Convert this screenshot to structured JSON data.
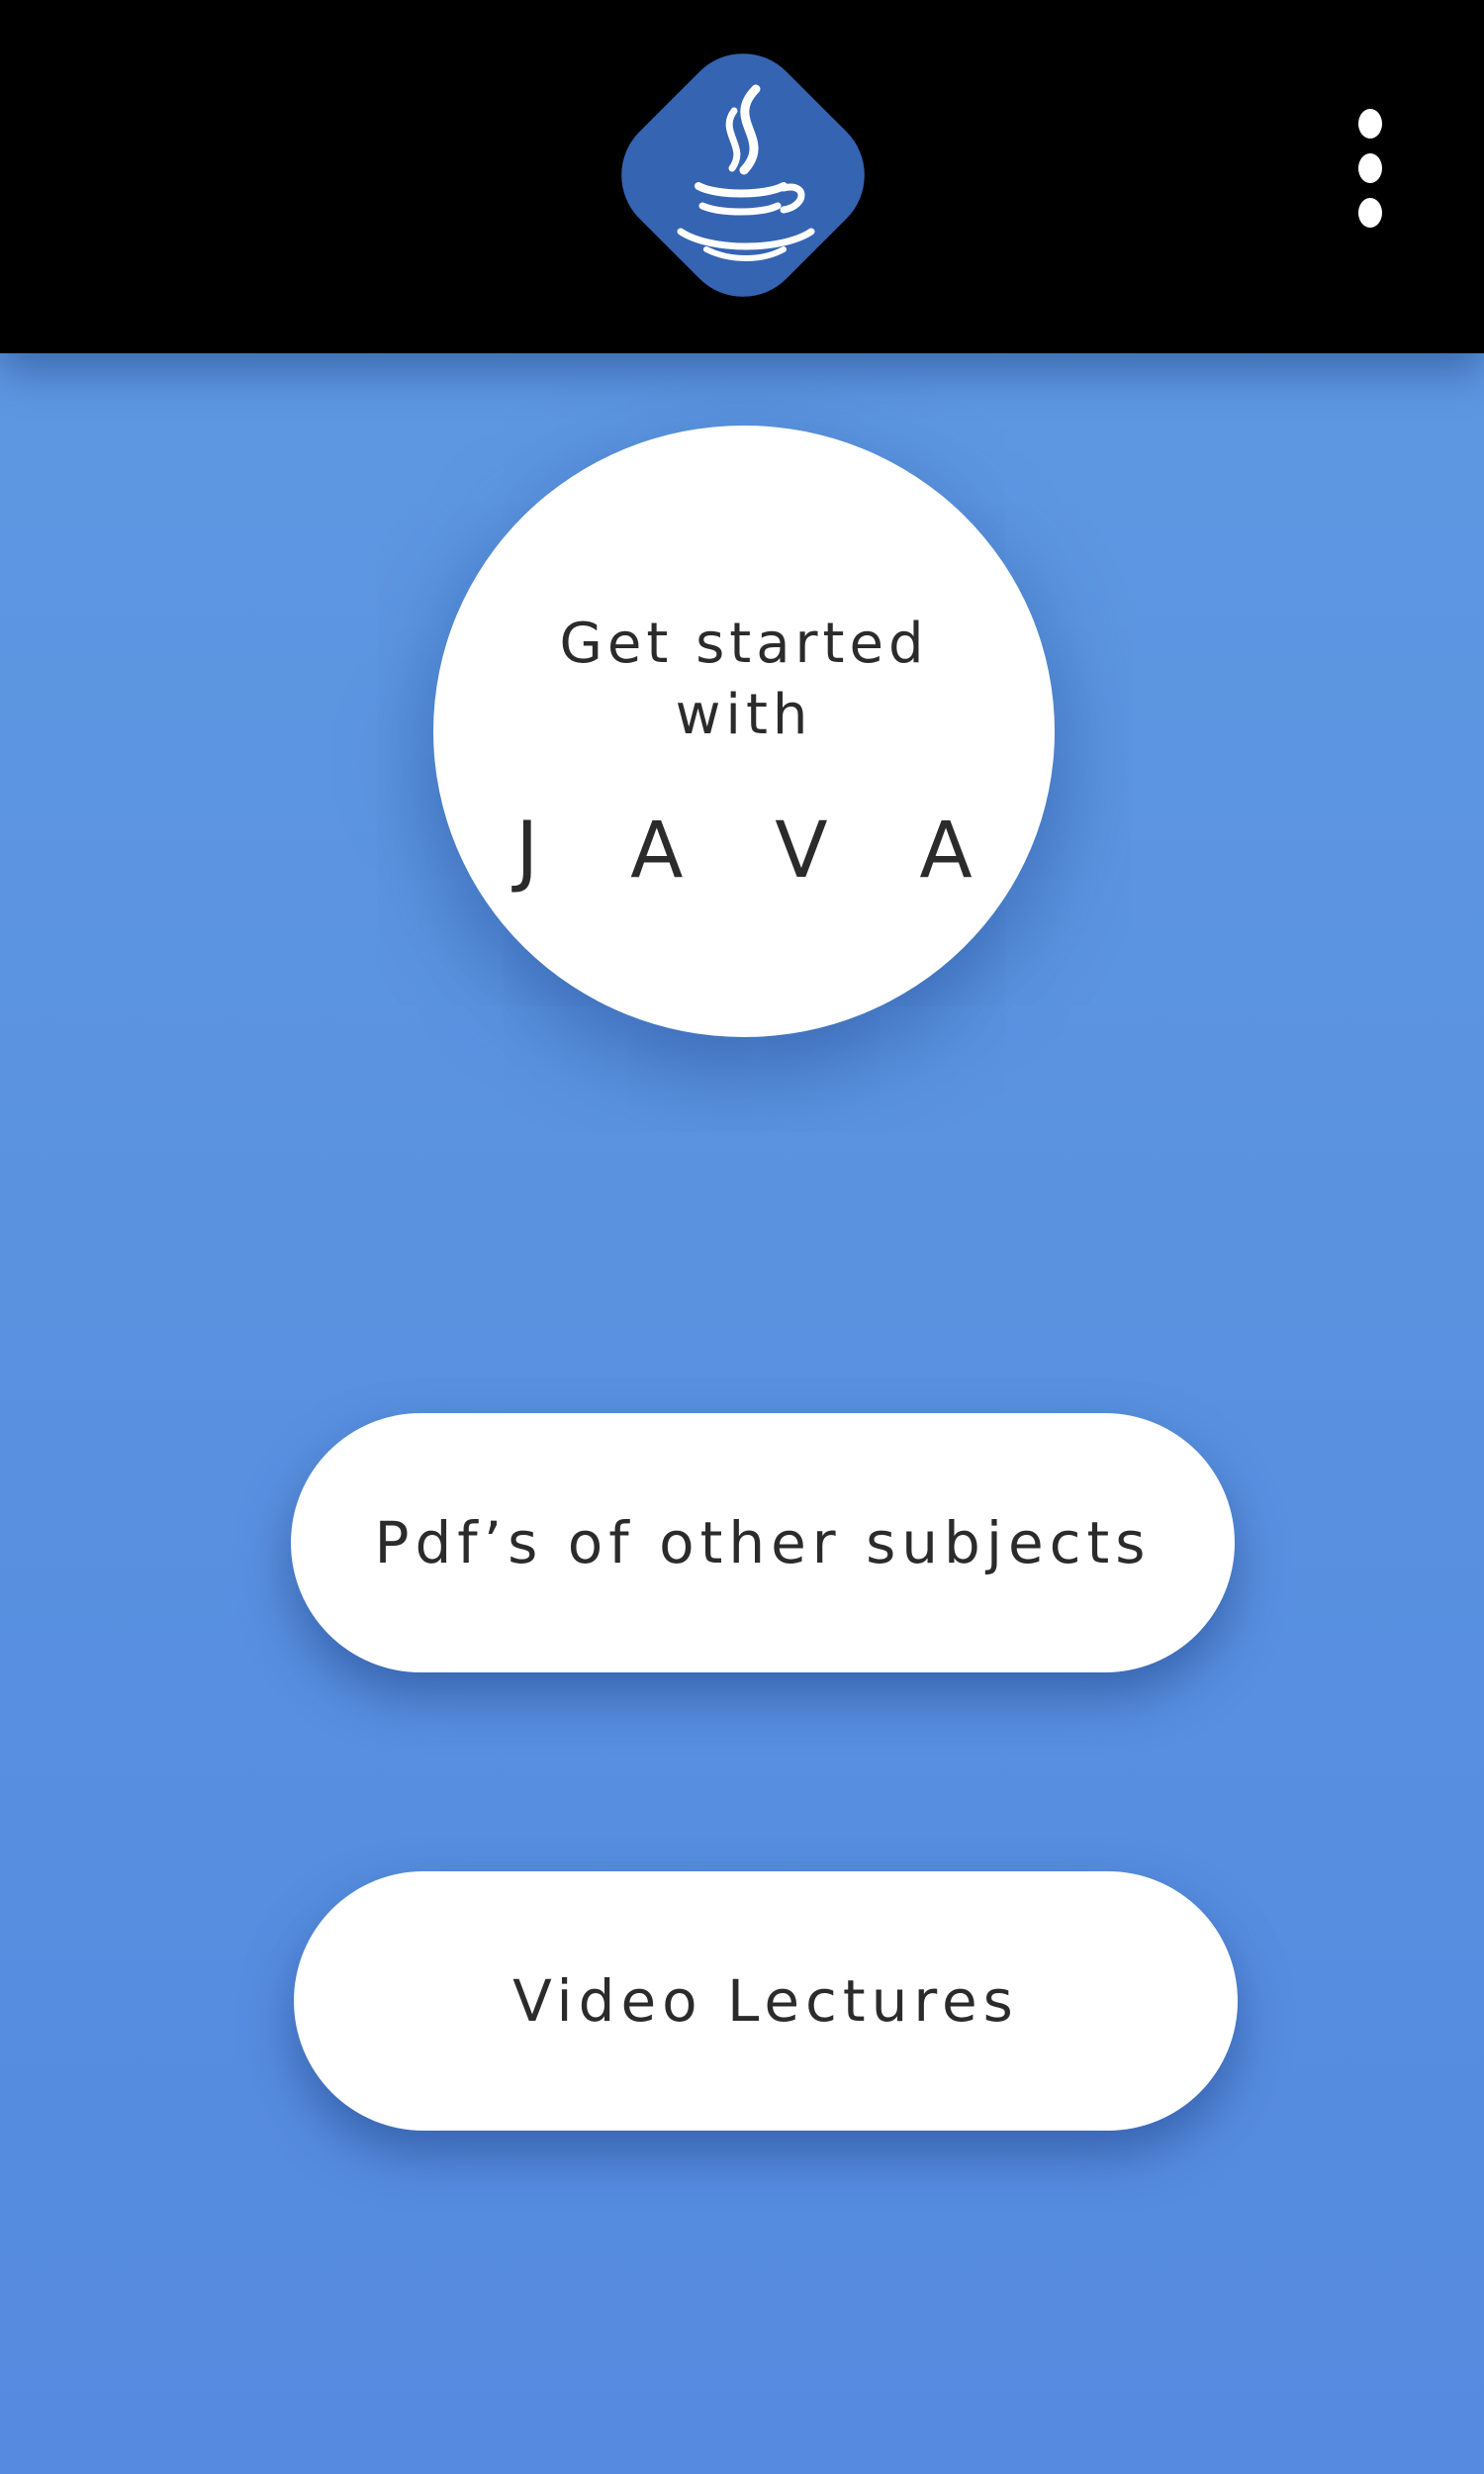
{
  "app_bar": {
    "logo_icon": "java-coffee-cup-logo",
    "menu_icon": "more-vert-icon",
    "logo_color": "#3564b3"
  },
  "hero": {
    "line1": "Get started",
    "line2": "with",
    "line3": "J A V A"
  },
  "buttons": {
    "pdf_label": "Pdf’s of other subjects",
    "video_label": "Video Lectures"
  },
  "colors": {
    "app_bar": "#000000",
    "background": "#5a92e0",
    "surface": "#ffffff",
    "text": "#2b2b2b"
  }
}
